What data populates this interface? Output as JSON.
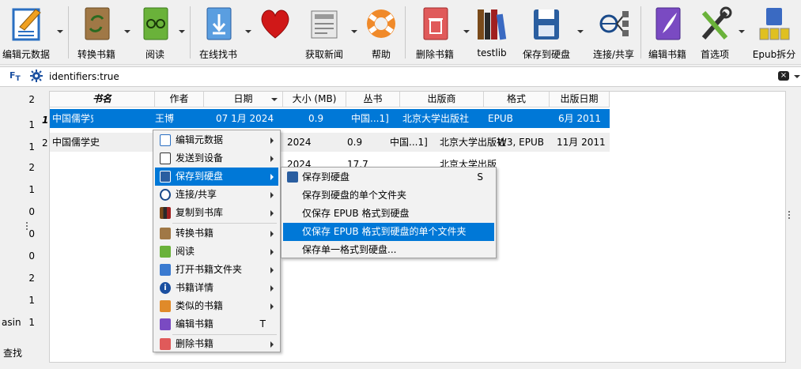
{
  "toolbar": {
    "edit_metadata": "编辑元数据",
    "convert": "转换书籍",
    "read": "阅读",
    "find_online": "在线找书",
    "donate": "",
    "fetch_news": "获取新闻",
    "help": "帮助",
    "remove": "删除书籍",
    "testlib": "testlib",
    "save_to_disk": "保存到硬盘",
    "connect_share": "连接/共享",
    "edit_book": "编辑书籍",
    "preferences": "首选项",
    "epub_split": "Epub拆分"
  },
  "search": {
    "query": "identifiers:true"
  },
  "columns": [
    "书名",
    "作者",
    "日期",
    "大小 (MB)",
    "丛书",
    "出版商",
    "格式",
    "出版日期"
  ],
  "rows": [
    {
      "num": "1",
      "title": "中国儒学史·先秦卷",
      "author": "王博",
      "date": "07 1月 2024",
      "size": "0.9",
      "series": "中国...1]",
      "publisher": "北京大学出版社",
      "format": "EPUB",
      "pubdate": "6月 2011"
    },
    {
      "num": "2",
      "title": "中国儒学史",
      "author": "",
      "date": "2024",
      "size": "0.9",
      "series": "中国...1]",
      "publisher": "北京大学出版社",
      "format": "W3, EPUB",
      "pubdate": "11月 2011"
    },
    {
      "num": "",
      "title": "",
      "author": "",
      "date": "2024",
      "size": "17.7",
      "series": "",
      "publisher": "北京大学出版",
      "format": "",
      "pubdate": ""
    }
  ],
  "left_counts": [
    "2",
    "1",
    "1",
    "2",
    "1",
    "0",
    "0",
    "0",
    "2",
    "1",
    "1"
  ],
  "left_labels": {
    "asin": "asin",
    "find": "查找"
  },
  "context_menu": {
    "items": [
      {
        "label": "编辑元数据"
      },
      {
        "label": "发送到设备"
      },
      {
        "label": "保存到硬盘"
      },
      {
        "label": "连接/共享"
      },
      {
        "label": "复制到书库"
      },
      {
        "label": "转换书籍"
      },
      {
        "label": "阅读"
      },
      {
        "label": "打开书籍文件夹"
      },
      {
        "label": "书籍详情"
      },
      {
        "label": "类似的书籍"
      },
      {
        "label": "编辑书籍",
        "shortcut": "T"
      },
      {
        "label": "删除书籍"
      }
    ]
  },
  "submenu": {
    "items": [
      {
        "label": "保存到硬盘",
        "shortcut": "S"
      },
      {
        "label": "保存到硬盘的单个文件夹"
      },
      {
        "label": "仅保存 EPUB 格式到硬盘"
      },
      {
        "label": "仅保存 EPUB 格式到硬盘的单个文件夹"
      },
      {
        "label": "保存单一格式到硬盘..."
      }
    ]
  },
  "colors": {
    "selection": "#0078d7",
    "toolbar_bg": "#f0f0f0"
  }
}
